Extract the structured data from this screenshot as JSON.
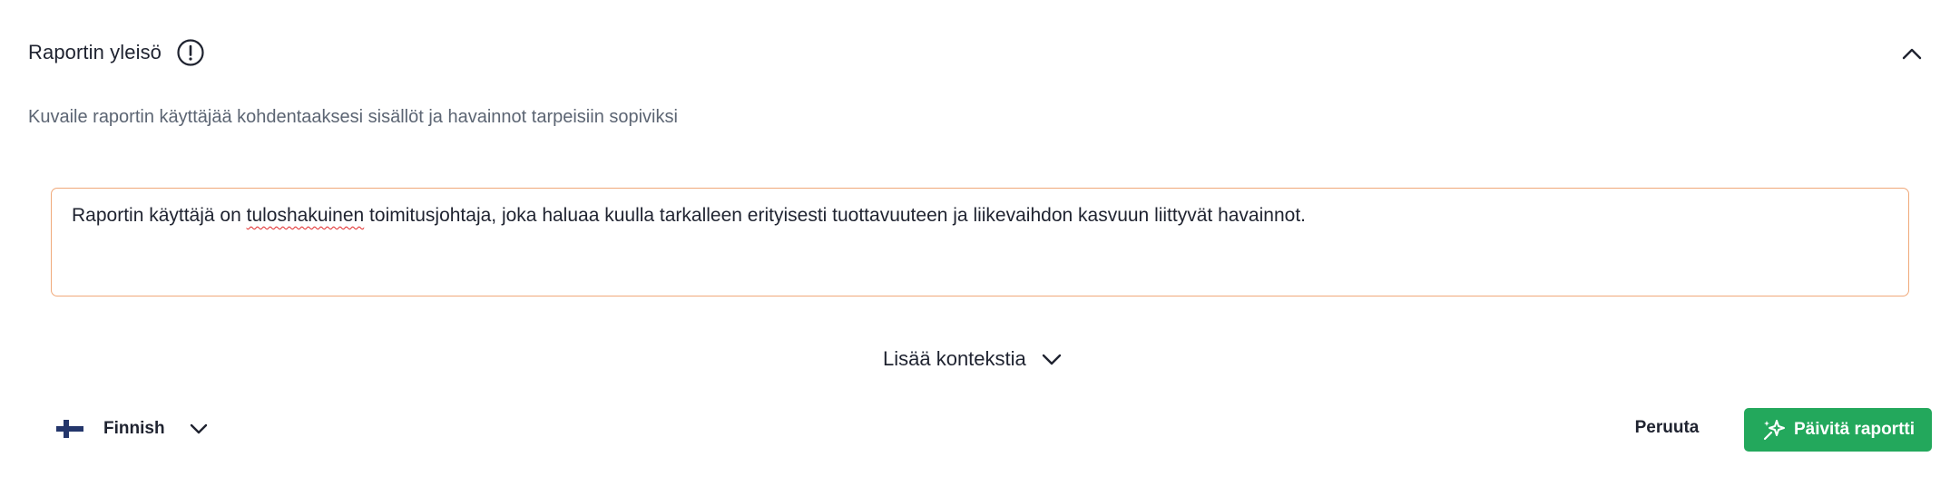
{
  "section": {
    "title": "Raportin yleisö",
    "info_icon": "exclamation-circle-icon",
    "collapse_icon": "chevron-up-icon",
    "description": "Kuvaile raportin käyttäjää kohdentaaksesi sisällöt ja havainnot tarpeisiin sopiviksi"
  },
  "audience_input": {
    "text_before": "Raportin käyttäjä on ",
    "misspelled_word": "tuloshakuinen",
    "text_after": " toimitusjohtaja, joka haluaa kuulla tarkalleen erityisesti tuottavuuteen ja liikevaihdon kasvuun liittyvät havainnot."
  },
  "more_context": {
    "label": "Lisää kontekstia",
    "icon": "chevron-down-icon"
  },
  "language": {
    "flag_icon": "finland-flag-icon",
    "selected": "Finnish",
    "icon": "chevron-down-icon"
  },
  "actions": {
    "cancel_label": "Peruuta",
    "update_label": "Päivitä raportti",
    "update_icon": "sparkle-icon"
  },
  "colors": {
    "primary": "#23a85c",
    "input_border": "#f0a97a",
    "text": "#1f2330",
    "muted_text": "#5c6573"
  }
}
